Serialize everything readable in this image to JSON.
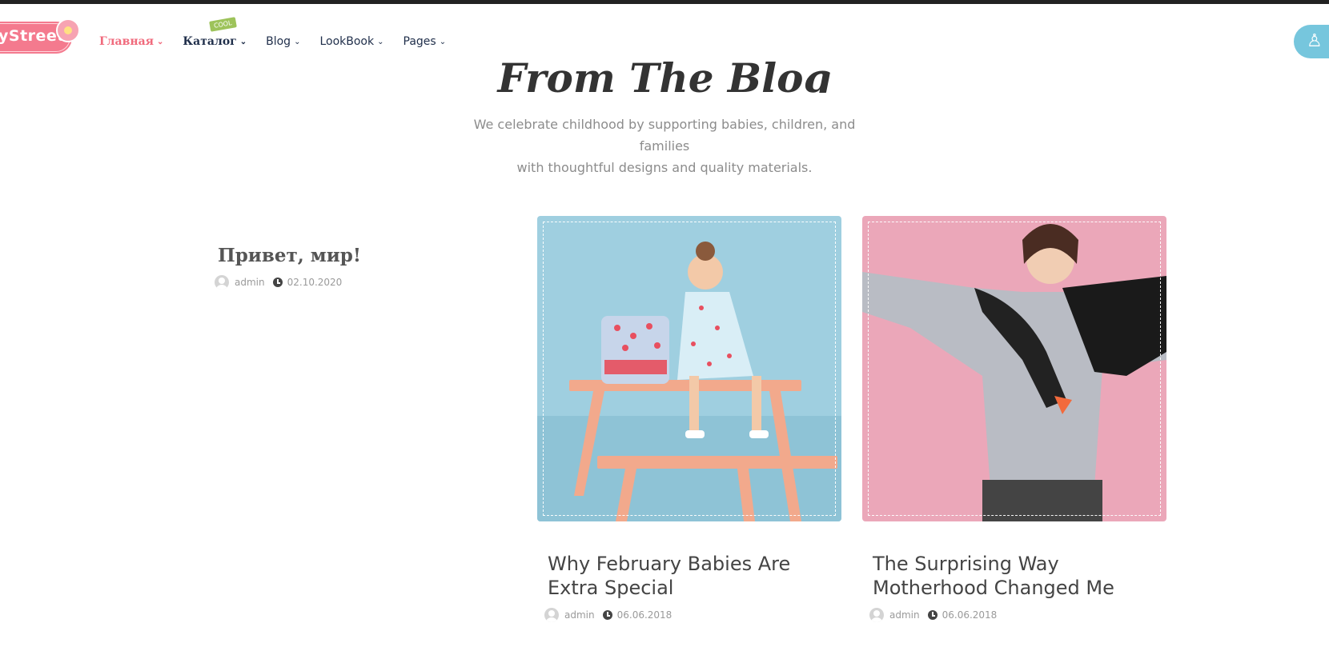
{
  "header": {
    "logo_text": "yStreet",
    "nav": [
      {
        "label": "Главная",
        "active": true
      },
      {
        "label": "Каталог",
        "badge": "COOL"
      },
      {
        "label": "Blog"
      },
      {
        "label": "LookBook"
      },
      {
        "label": "Pages"
      }
    ],
    "user_icon": "user-icon"
  },
  "section": {
    "title": "From The Blog",
    "subtitle_line1": "We celebrate childhood by supporting babies, children, and families",
    "subtitle_line2": "with thoughtful designs and quality materials."
  },
  "posts": [
    {
      "title": "Привет, мир!",
      "author": "admin",
      "date": "02.10.2020"
    },
    {
      "title": "Why February Babies Are Extra Special",
      "author": "admin",
      "date": "06.06.2018",
      "image_bg": "#9fcfe0"
    },
    {
      "title": "The Surprising Way Motherhood Changed Me",
      "author": "admin",
      "date": "06.06.2018",
      "image_bg": "#eba7b9"
    }
  ],
  "colors": {
    "accent": "#f06a7c",
    "nav_text": "#1f2e4a",
    "user_button": "#76c6dd",
    "badge": "#9dc35a"
  }
}
